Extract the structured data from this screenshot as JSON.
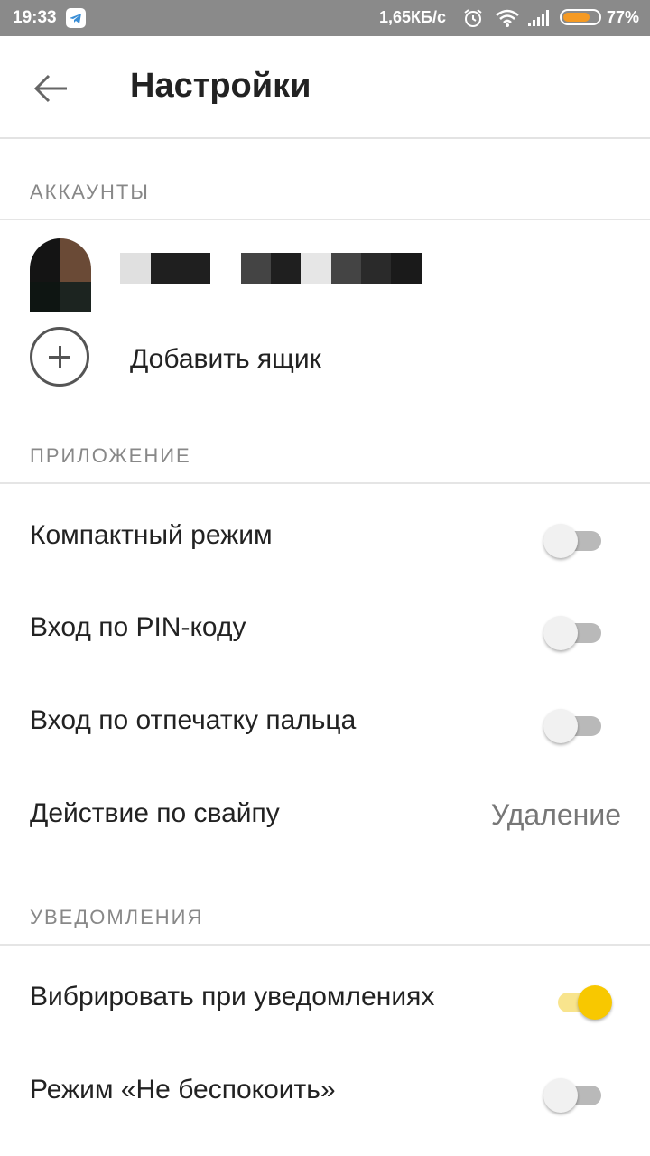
{
  "status_bar": {
    "time": "19:33",
    "speed": "1,65КБ/с",
    "battery_pct": "77%",
    "battery_level": 0.77,
    "icons": [
      "telegram-icon",
      "alarm-icon",
      "wifi-icon",
      "signal-icon",
      "battery-icon"
    ]
  },
  "appbar": {
    "title": "Настройки"
  },
  "sections": {
    "accounts": "АККАУНТЫ",
    "app": "ПРИЛОЖЕНИЕ",
    "notifications": "УВЕДОМЛЕНИЯ"
  },
  "accounts": {
    "add_label": "Добавить ящик"
  },
  "app_settings": {
    "compact_mode": {
      "label": "Компактный режим",
      "on": false
    },
    "pin_login": {
      "label": "Вход по PIN-коду",
      "on": false
    },
    "fingerprint_login": {
      "label": "Вход по отпечатку пальца",
      "on": false
    },
    "swipe_action": {
      "label": "Действие по свайпу",
      "value": "Удаление"
    }
  },
  "notification_settings": {
    "vibrate": {
      "label": "Вибрировать при уведомлениях",
      "on": true
    },
    "dnd": {
      "label": "Режим «Не беспокоить»",
      "on": false
    }
  },
  "colors": {
    "accent": "#f8c800",
    "status_bar": "#8a8a8a",
    "battery": "#f59a23"
  }
}
